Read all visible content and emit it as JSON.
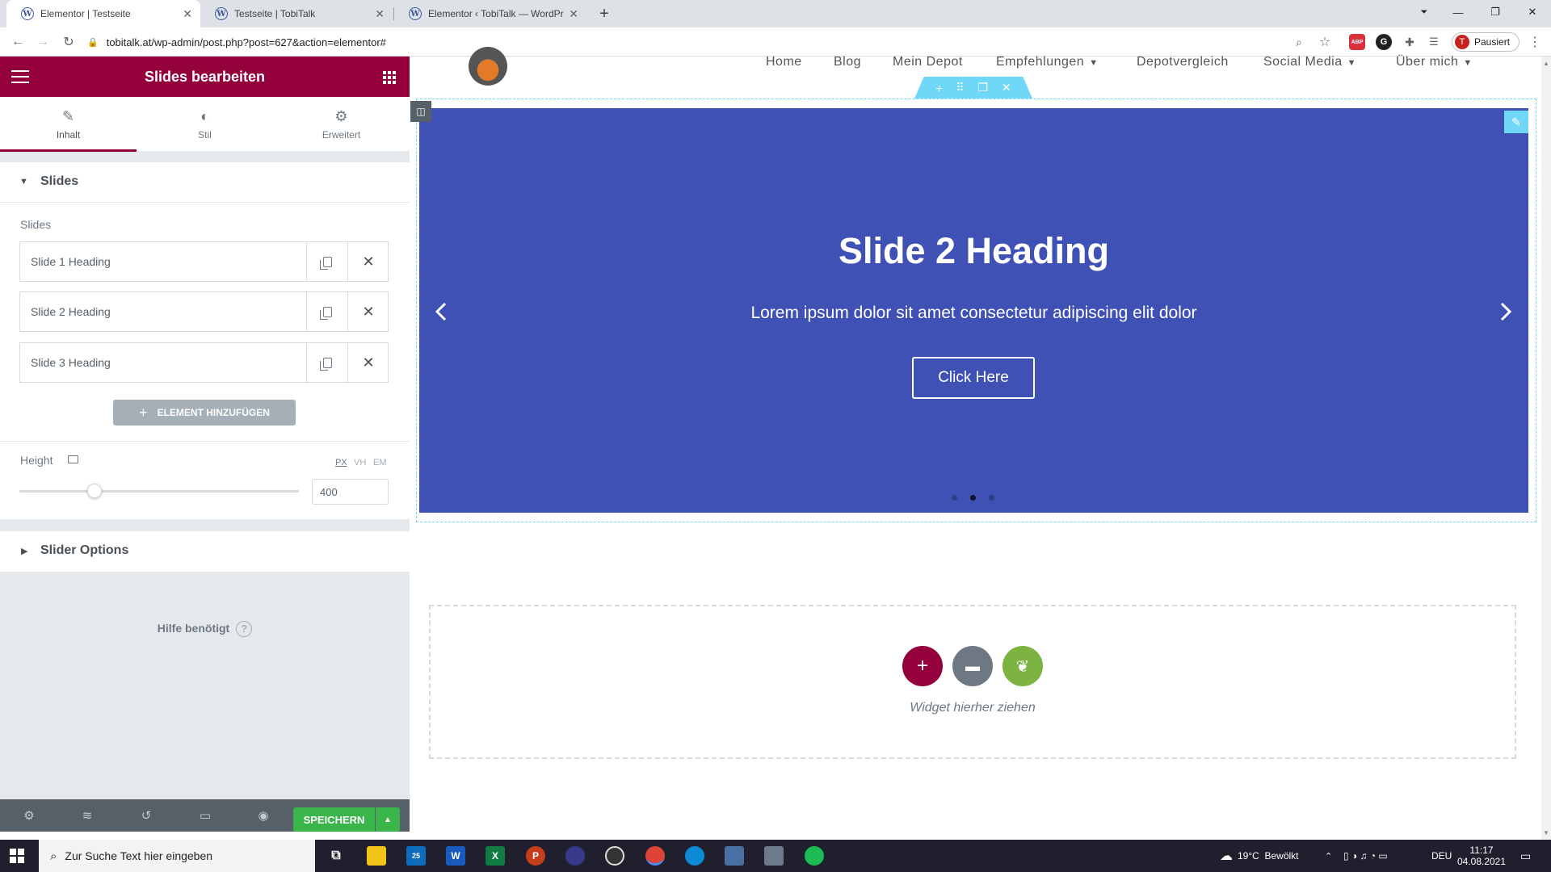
{
  "browser": {
    "tabs": [
      {
        "title": "Elementor | Testseite",
        "active": true
      },
      {
        "title": "Testseite | TobiTalk",
        "active": false
      },
      {
        "title": "Elementor ‹ TobiTalk — WordPre",
        "active": false
      }
    ],
    "url": "tobitalk.at/wp-admin/post.php?post=627&action=elementor#",
    "profile_initial": "T",
    "profile_label": "Pausiert",
    "ext_abp": "ABP"
  },
  "panel": {
    "title": "Slides bearbeiten",
    "tabs": [
      {
        "label": "Inhalt",
        "icon": "pencil-icon"
      },
      {
        "label": "Stil",
        "icon": "contrast-icon"
      },
      {
        "label": "Erweitert",
        "icon": "gear-icon"
      }
    ],
    "slides_section_title": "Slides",
    "slides_label": "Slides",
    "slides": [
      "Slide 1 Heading",
      "Slide 2 Heading",
      "Slide 3 Heading"
    ],
    "add_label": "ELEMENT HINZUFÜGEN",
    "height_label": "Height",
    "units": [
      "PX",
      "VH",
      "EM"
    ],
    "height_value": "400",
    "height_slider_fraction": 0.27,
    "slider_options_title": "Slider Options",
    "help_label": "Hilfe benötigt",
    "save_label": "SPEICHERN",
    "accent": "#93003c"
  },
  "site": {
    "nav": [
      {
        "label": "Home"
      },
      {
        "label": "Blog"
      },
      {
        "label": "Mein Depot"
      },
      {
        "label": "Empfehlungen",
        "dropdown": true
      },
      {
        "label": "Depotvergleich"
      },
      {
        "label": "Social Media",
        "dropdown": true
      },
      {
        "label": "Über mich",
        "dropdown": true
      }
    ],
    "slide": {
      "heading": "Slide 2 Heading",
      "description": "Lorem ipsum dolor sit amet consectetur adipiscing elit dolor",
      "button": "Click Here",
      "background": "#3f51b5",
      "active_dot": 2,
      "dot_count": 3
    },
    "drop_zone_text": "Widget hierher ziehen"
  },
  "taskbar": {
    "search_placeholder": "Zur Suche Text hier eingeben",
    "mail_badge": "25",
    "weather": "19°C  Bewölkt",
    "lang": "DEU",
    "time": "11:17",
    "date": "04.08.2021"
  }
}
